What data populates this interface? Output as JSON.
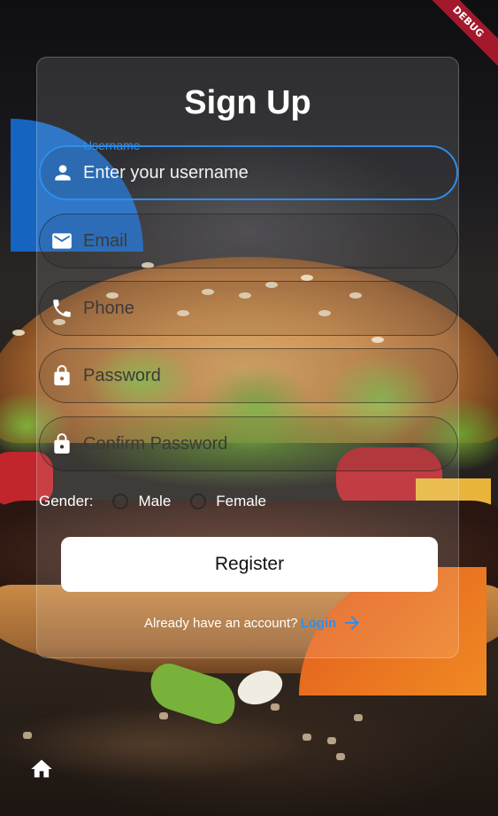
{
  "debug_banner": "DEBUG",
  "form": {
    "title": "Sign Up",
    "fields": [
      {
        "floating_label": "Username",
        "text": "Enter your username",
        "icon": "person-icon",
        "active": true
      },
      {
        "text": "Email",
        "icon": "mail-icon"
      },
      {
        "text": "Phone",
        "icon": "phone-icon"
      },
      {
        "text": "Password",
        "icon": "lock-icon"
      },
      {
        "text": "Confirm Password",
        "icon": "lock-icon"
      }
    ],
    "gender": {
      "label": "Gender:",
      "options": [
        "Male",
        "Female"
      ]
    },
    "register_label": "Register",
    "login_prompt": "Already have an account?",
    "login_link": "Login"
  },
  "colors": {
    "accent": "#2f8ee8",
    "blue_shape": "#1565c0",
    "orange_shape": "#f08a24",
    "debug": "#a3192b"
  }
}
